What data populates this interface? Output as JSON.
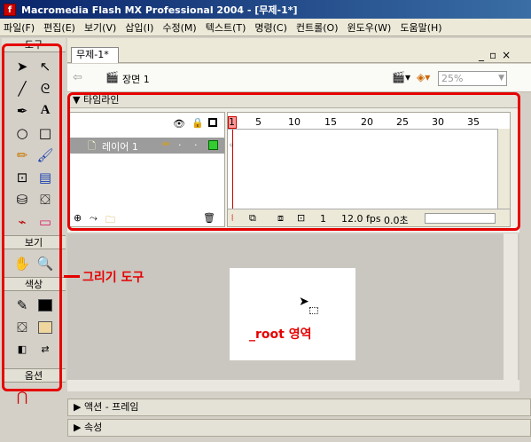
{
  "window": {
    "title": "Macromedia Flash MX Professional 2004 - [무제-1*]"
  },
  "menu": [
    "파일(F)",
    "편집(E)",
    "보기(V)",
    "삽입(I)",
    "수정(M)",
    "텍스트(T)",
    "명령(C)",
    "컨트롤(O)",
    "윈도우(W)",
    "도움말(H)"
  ],
  "tools": {
    "header": "도구",
    "view_label": "보기",
    "color_label": "색상",
    "options_label": "옵션"
  },
  "document": {
    "tab": "무제-1*",
    "scene": "장면 1",
    "zoom": "25%"
  },
  "timeline": {
    "title": "타임라인",
    "layer_name": "레이어 1",
    "frame_numbers": [
      "1",
      "5",
      "10",
      "15",
      "20",
      "25",
      "30",
      "35"
    ],
    "current_frame": "1",
    "fps": "12.0 fps",
    "elapsed": "0.0초"
  },
  "annotations": {
    "drawing_tools": "그리기 도구",
    "root_area": "_root 영역"
  },
  "panels": {
    "actions": "액션 - 프레임",
    "properties": "속성"
  },
  "colors": {
    "accent_red": "#e60000",
    "titlebar": "#0a246a"
  }
}
